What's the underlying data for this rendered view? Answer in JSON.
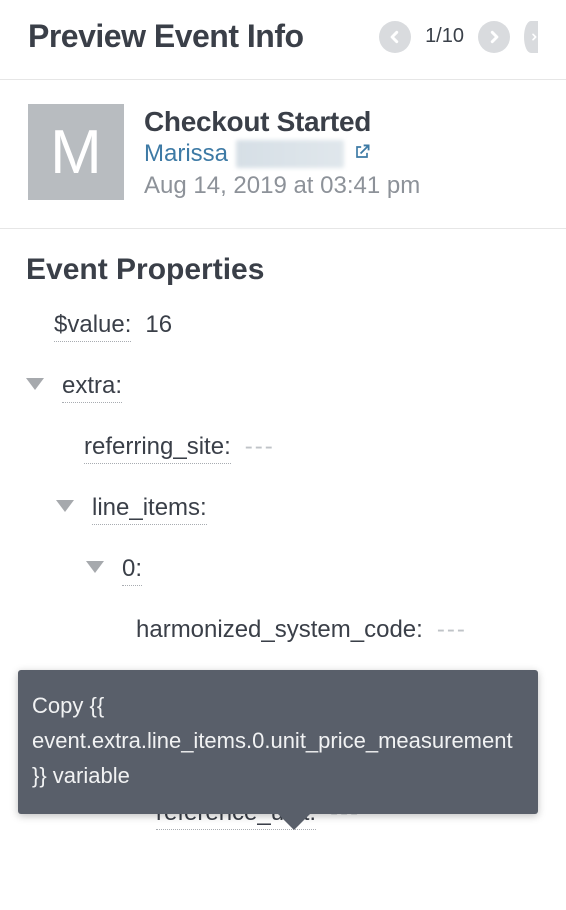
{
  "header": {
    "title": "Preview Event Info",
    "pager": "1/10"
  },
  "event": {
    "avatar_initial": "M",
    "name": "Checkout Started",
    "user_name": "Marissa",
    "timestamp": "Aug 14, 2019 at 03:41 pm"
  },
  "props": {
    "section_title": "Event Properties",
    "value_key": "$value:",
    "value_val": "16",
    "extra_key": "extra:",
    "referring_site_key": "referring_site:",
    "referring_site_val": "---",
    "line_items_key": "line_items:",
    "idx0_key": "0:",
    "hsc_key": "harmonized_system_code:",
    "hsc_val": "---",
    "upm_key": "unit_price_measurement:",
    "ref_unit_key": "reference_unit:",
    "ref_unit_val": "---"
  },
  "tooltip": {
    "text": "Copy {{ event.extra.line_items.0.unit_price_measurement }} variable"
  }
}
